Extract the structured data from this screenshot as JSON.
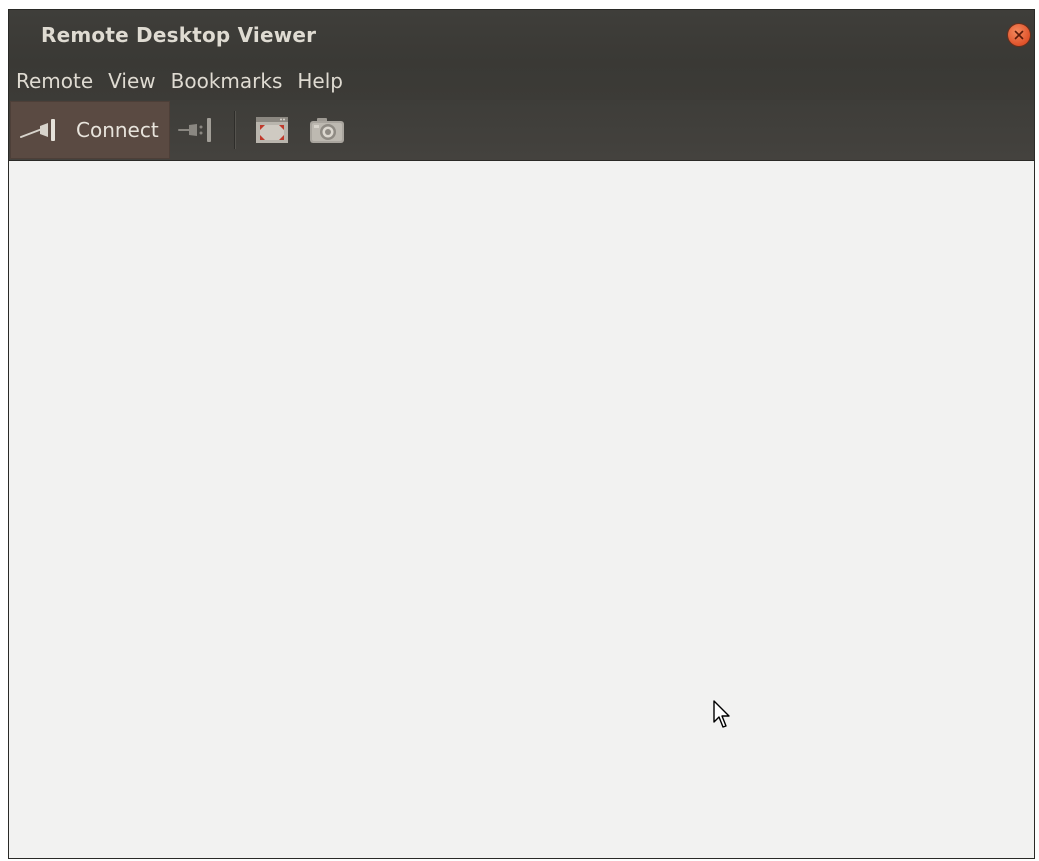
{
  "window": {
    "title": "Remote Desktop Viewer"
  },
  "menubar": {
    "items": [
      {
        "label": "Remote"
      },
      {
        "label": "View"
      },
      {
        "label": "Bookmarks"
      },
      {
        "label": "Help"
      }
    ]
  },
  "toolbar": {
    "connect_label": "Connect",
    "icons": {
      "connect": "plug-connect-icon",
      "disconnect": "plug-disconnect-icon",
      "fullscreen": "fullscreen-icon",
      "screenshot": "camera-icon"
    }
  },
  "colors": {
    "titlebar": "#3c3b37",
    "close_button": "#e95420",
    "connect_active": "#5a4a42",
    "content_background": "#f2f2f1"
  }
}
